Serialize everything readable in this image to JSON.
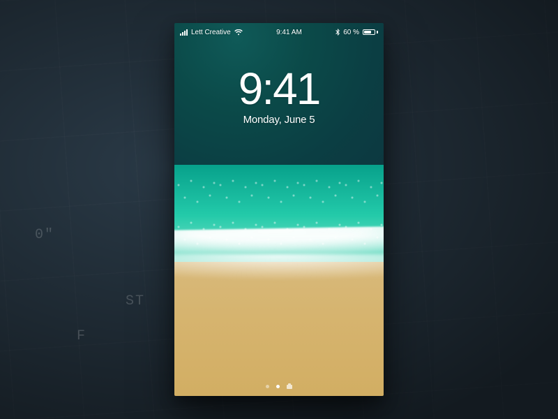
{
  "status_bar": {
    "carrier": "Lett Creative",
    "time": "9:41 AM",
    "battery_pct": "60 %"
  },
  "lockscreen": {
    "time": "9:41",
    "date": "Monday, June 5"
  },
  "background_labels": {
    "a": "0\"",
    "b": "ST",
    "c": "F"
  }
}
